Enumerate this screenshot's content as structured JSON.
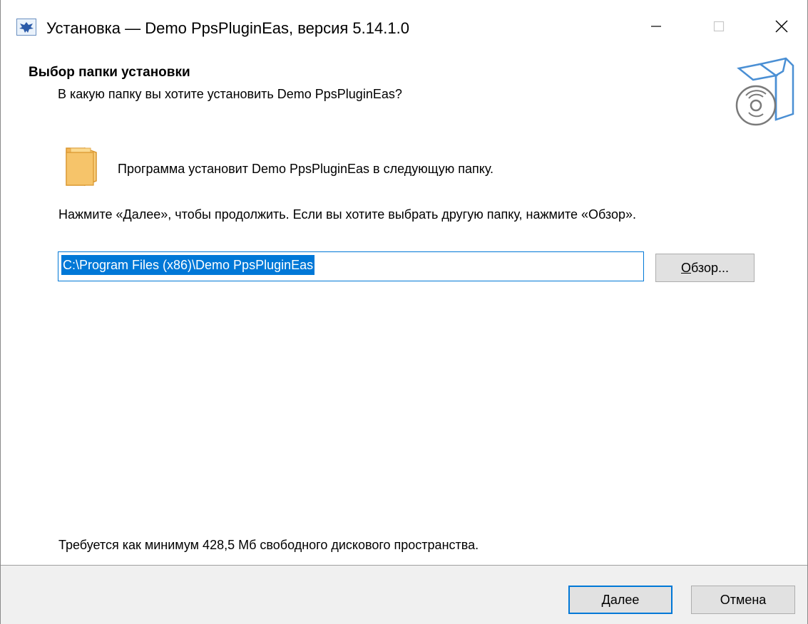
{
  "window": {
    "title": "Установка — Demo PpsPluginEas, версия 5.14.1.0"
  },
  "header": {
    "title": "Выбор папки установки",
    "subtitle": "В какую папку вы хотите установить Demo PpsPluginEas?"
  },
  "content": {
    "description": "Программа установит Demo PpsPluginEas в следующую папку.",
    "instruction": "Нажмите «Далее», чтобы продолжить. Если вы хотите выбрать другую папку, нажмите «Обзор».",
    "install_path": "C:\\Program Files (x86)\\Demo PpsPluginEas",
    "browse_label_accel": "О",
    "browse_label_rest": "бзор...",
    "disk_space": "Требуется как минимум 428,5 Мб свободного дискового пространства."
  },
  "footer": {
    "next_label_accel": "Д",
    "next_label_rest": "алее",
    "cancel_label": "Отмена"
  },
  "icons": {
    "app": "app-eagle-icon",
    "setup": "setup-box-disc-icon",
    "folder": "folder-icon",
    "minimize": "minimize-icon",
    "maximize": "maximize-icon",
    "close": "close-icon"
  },
  "colors": {
    "accent": "#0078d7",
    "footer_bg": "#f0f0f0",
    "button_bg": "#e1e1e1",
    "folder_fill": "#f8c96a"
  }
}
